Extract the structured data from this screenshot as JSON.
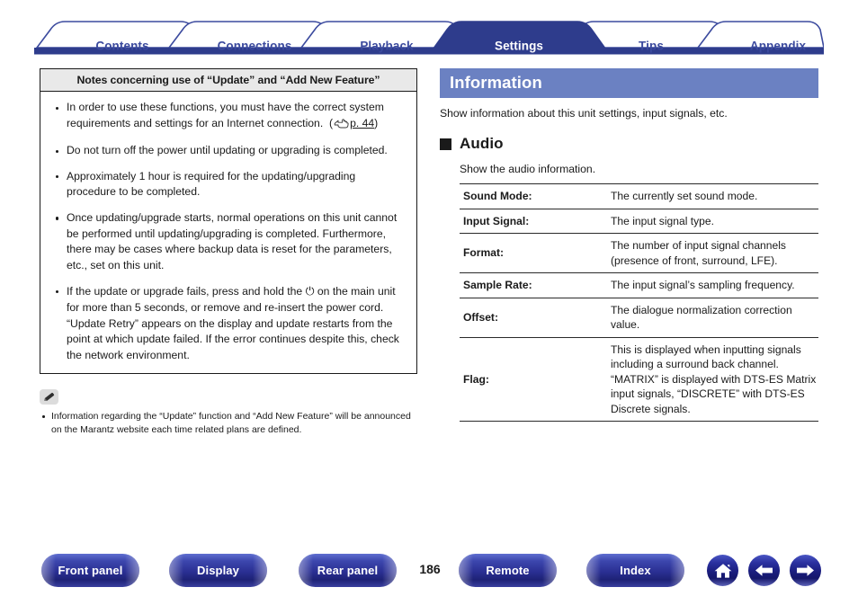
{
  "tabs": [
    {
      "label": "Contents",
      "active": false
    },
    {
      "label": "Connections",
      "active": false
    },
    {
      "label": "Playback",
      "active": false
    },
    {
      "label": "Settings",
      "active": true
    },
    {
      "label": "Tips",
      "active": false
    },
    {
      "label": "Appendix",
      "active": false
    }
  ],
  "notes_box": {
    "title": "Notes concerning use of “Update” and “Add New Feature”",
    "items": [
      {
        "text_before": "In order to use these functions, you must have the correct system requirements and settings for an Internet connection.  (",
        "link": "p. 44",
        "text_after": ")"
      },
      {
        "text_before": "Do not turn off the power until updating or upgrading is completed."
      },
      {
        "text_before": "Approximately 1 hour is required for the updating/upgrading procedure to be completed."
      },
      {
        "text_before": "Once updating/upgrade starts, normal operations on this unit cannot be performed until updating/upgrading is completed. Furthermore, there may be cases where backup data is reset for the parameters, etc., set on this unit."
      },
      {
        "power_sentence_a": "If the update or upgrade fails, press and hold the ",
        "power_glyph": "⏻",
        "power_sentence_b": " on the main unit for more than 5 seconds, or remove and re-insert the power cord. “Update Retry” appears on the display and update restarts from the point at which update failed. If the error continues despite this, check the network environment."
      }
    ]
  },
  "memo": {
    "icon": "pencil-icon",
    "text": "Information regarding the “Update” function and “Add New Feature” will be announced on the Marantz website each time related plans are defined."
  },
  "information": {
    "header": "Information",
    "subtitle": "Show information about this unit settings, input signals, etc.",
    "section_title": "Audio",
    "section_desc": "Show the audio information.",
    "rows": [
      {
        "key": "Sound Mode:",
        "value": "The currently set sound mode."
      },
      {
        "key": "Input Signal:",
        "value": "The input signal type."
      },
      {
        "key": "Format:",
        "value": "The number of input signal channels (presence of front, surround, LFE)."
      },
      {
        "key": "Sample Rate:",
        "value": "The input signal’s sampling frequency."
      },
      {
        "key": "Offset:",
        "value": "The dialogue normalization correction value."
      },
      {
        "key": "Flag:",
        "value": "This is displayed when inputting signals including a surround back channel. “MATRIX” is displayed with DTS-ES Matrix input signals, “DISCRETE” with DTS-ES Discrete signals."
      }
    ]
  },
  "bottom": {
    "buttons": [
      {
        "label": "Front panel"
      },
      {
        "label": "Display"
      },
      {
        "label": "Rear panel"
      },
      {
        "label": "Remote"
      },
      {
        "label": "Index"
      }
    ],
    "page_number": "186",
    "icons": [
      {
        "name": "home-icon"
      },
      {
        "name": "arrow-left-icon"
      },
      {
        "name": "arrow-right-icon"
      }
    ]
  },
  "colors": {
    "tab_active_bg": "#2e3c8c",
    "tab_text": "#3b4a9e",
    "info_header_bg": "#6b81c2",
    "notes_title_bg": "#e9e9e9",
    "pill_blue": "#2a2f92"
  }
}
